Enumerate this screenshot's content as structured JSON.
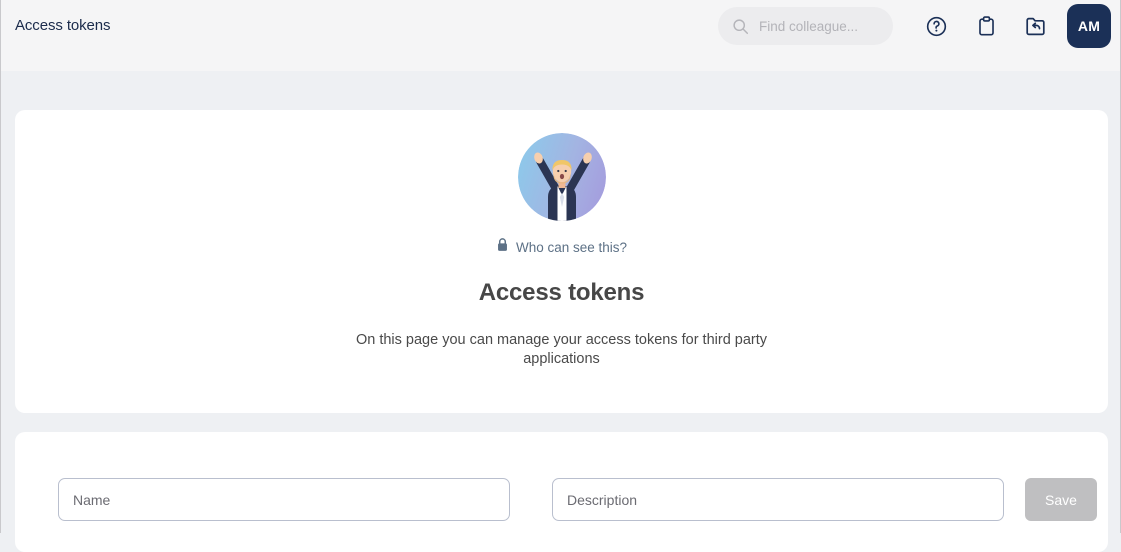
{
  "header": {
    "title": "Access tokens",
    "search": {
      "placeholder": "Find colleague...",
      "value": "",
      "icon": "search-icon"
    },
    "icons": [
      {
        "name": "help-circle-icon",
        "label": "Help"
      },
      {
        "name": "clipboard-icon",
        "label": "Clipboard"
      },
      {
        "name": "folder-back-icon",
        "label": "Folder"
      }
    ],
    "avatar": {
      "initials": "AM"
    }
  },
  "hero": {
    "illustration_name": "celebrating-person-illustration",
    "visibility": {
      "icon": "lock-icon",
      "label": "Who can see this?"
    },
    "title": "Access tokens",
    "description": "On this page you can manage your access tokens for third party applications"
  },
  "form": {
    "name_field": {
      "placeholder": "Name",
      "value": ""
    },
    "description_field": {
      "placeholder": "Description",
      "value": ""
    },
    "save_label": "Save"
  },
  "colors": {
    "page_background": "#eef0f3",
    "header_background": "#f5f5f6",
    "card_background": "#ffffff",
    "brand_navy": "#1b3057",
    "muted_text": "#5d7186",
    "disabled_button": "#bfbfc1",
    "field_border": "#b9bfce"
  }
}
